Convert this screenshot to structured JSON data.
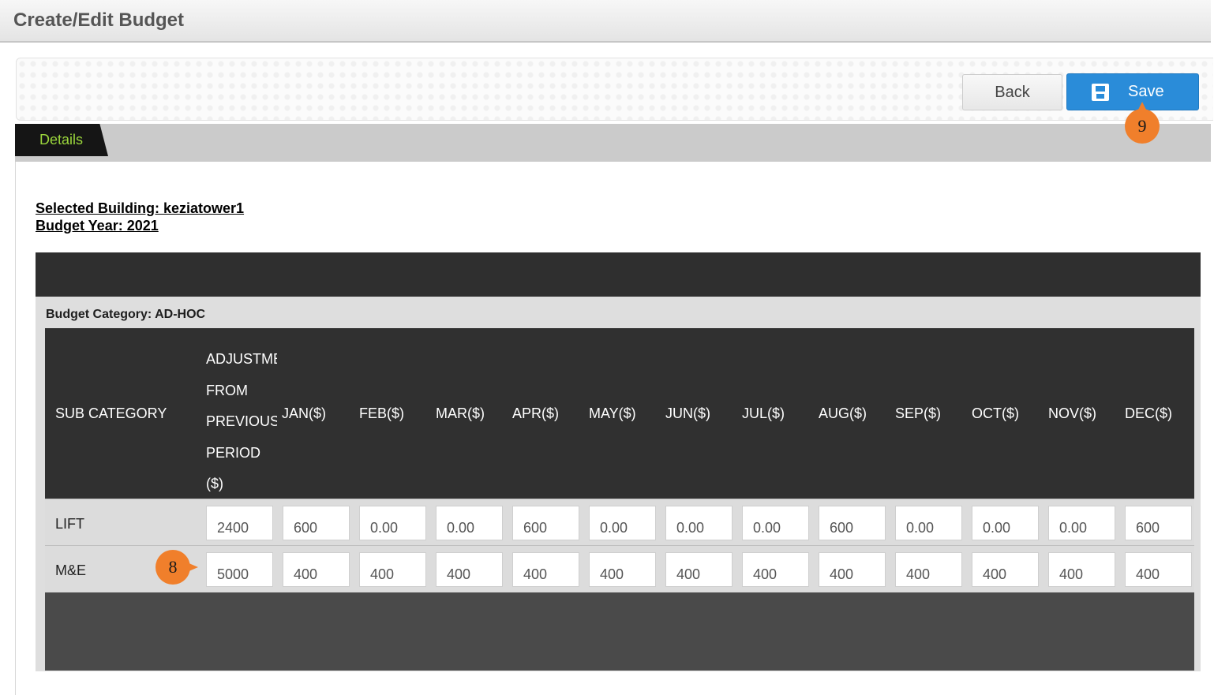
{
  "page": {
    "title": "Create/Edit Budget"
  },
  "toolbar": {
    "back_label": "Back",
    "save_label": "Save"
  },
  "tabs": [
    {
      "label": "Details"
    }
  ],
  "info": {
    "building": "Selected Building: keziatower1",
    "year": "Budget Year: 2021"
  },
  "category": {
    "label": "Budget Category: AD-HOC"
  },
  "table": {
    "headers": {
      "sub_category": "SUB CATEGORY",
      "adjustment": [
        "ADJUSTMENT",
        "FROM",
        "PREVIOUS",
        "PERIOD",
        "($)"
      ],
      "months": [
        "JAN($)",
        "FEB($)",
        "MAR($)",
        "APR($)",
        "MAY($)",
        "JUN($)",
        "JUL($)",
        "AUG($)",
        "SEP($)",
        "OCT($)",
        "NOV($)",
        "DEC($)"
      ]
    },
    "rows": [
      {
        "label": "LIFT",
        "values": [
          "2400",
          "600",
          "0.00",
          "0.00",
          "600",
          "0.00",
          "0.00",
          "0.00",
          "600",
          "0.00",
          "0.00",
          "0.00",
          "600"
        ]
      },
      {
        "label": "M&E",
        "values": [
          "5000",
          "400",
          "400",
          "400",
          "400",
          "400",
          "400",
          "400",
          "400",
          "400",
          "400",
          "400",
          "400"
        ]
      }
    ]
  },
  "markers": {
    "save_step": "9",
    "row_step": "8"
  },
  "colors": {
    "primary": "#2a8cd9",
    "marker": "#f07f2b",
    "tab_text": "#9bd63c",
    "header_bg": "#303030"
  }
}
